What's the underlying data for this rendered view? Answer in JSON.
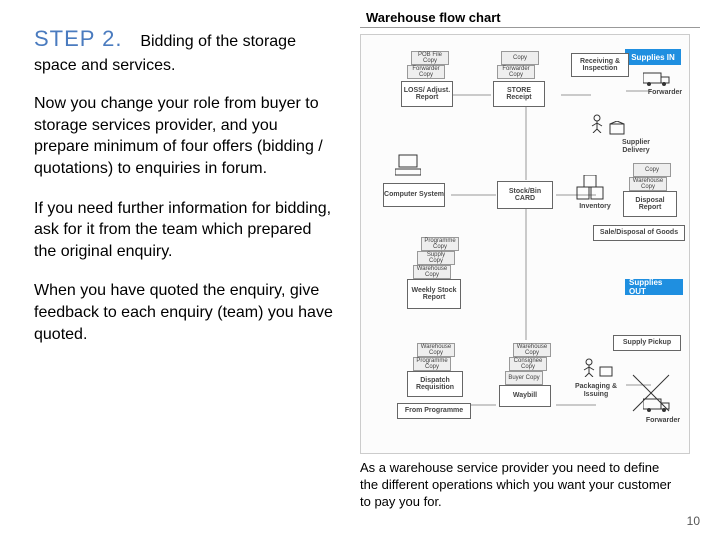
{
  "left": {
    "step_label": "STEP 2.",
    "step_rest": "Bidding of the storage space and services.",
    "p1": "Now you change your role from buyer to storage services provider, and you prepare minimum of four offers (bidding / quotations) to enquiries in forum.",
    "p2": "If you need further information for bidding, ask for it from the team which prepared the original enquiry.",
    "p3": "When you have quoted the enquiry, give feedback to each enquiry (team) you have quoted."
  },
  "chart": {
    "title": "Warehouse flow chart",
    "supplies_in": "Supplies IN",
    "supplies_out": "Supplies OUT",
    "recv": "Receiving & Inspection",
    "store_receipt": "STORE Receipt",
    "loss": "LOSS/ Adjust. Report",
    "comp": "Computer System",
    "stockbin": "Stock/Bin CARD",
    "inventory": "Inventory",
    "disposal": "Disposal Report",
    "sale": "Sale/Disposal of Goods",
    "weekly": "Weekly Stock Report",
    "dispatch": "Dispatch Requisition",
    "waybill": "Waybill",
    "from_prog": "From Programme",
    "pkg": "Packaging & Issuing",
    "forwarder": "Forwarder",
    "supplier": "Supplier Delivery",
    "supply_pickup": "Supply Pickup",
    "c_pob": "POB File Copy",
    "c_fwd": "Forwarder Copy",
    "c_copy": "Copy",
    "c_wh": "Warehouse Copy",
    "c_prog": "Programme Copy",
    "c_supply": "Supply Copy",
    "c_consignee": "Consignee Copy",
    "c_buyer": "Buyer Copy"
  },
  "caption": "As a warehouse service provider you need to define the different operations which you want your customer to pay you for.",
  "page_num": "10"
}
